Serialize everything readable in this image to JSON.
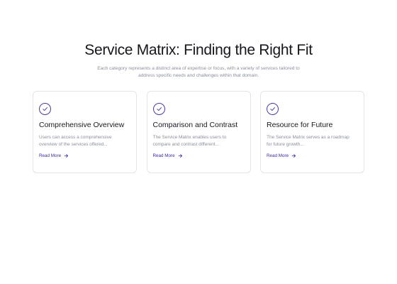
{
  "header": {
    "title": "Service Matrix: Finding the Right Fit",
    "subtitle": "Each category represents a distinct area of expertise or focus, with a variety of services tailored to address specific needs and challenges within that domain."
  },
  "cards": [
    {
      "icon": "check-circle-icon",
      "title": "Comprehensive Overview",
      "description": "Users can access a comprehensive overview of the services offered...",
      "link_label": "Read More"
    },
    {
      "icon": "check-circle-icon",
      "title": "Comparison and Contrast",
      "description": "The Service Matrix enables users to compare and contrast different...",
      "link_label": "Read More"
    },
    {
      "icon": "check-circle-icon",
      "title": "Resource for Future",
      "description": "The Service Matrix serves as a roadmap for future growth...",
      "link_label": "Read More"
    }
  ],
  "colors": {
    "accent": "#3b2fa0",
    "text": "#15171d",
    "muted": "#8a8f9a",
    "border": "#e3e5ea"
  }
}
